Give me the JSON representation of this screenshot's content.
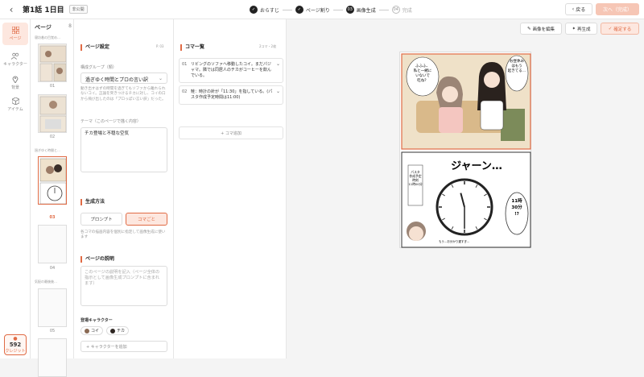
{
  "topbar": {
    "title": "第1話 1日目",
    "badge": "非公開",
    "steps": [
      {
        "num": "✓",
        "label": "おらすじ"
      },
      {
        "num": "✓",
        "label": "ページ割り"
      },
      {
        "num": "03",
        "label": "画像生成"
      },
      {
        "num": "04",
        "label": "完成"
      }
    ],
    "back_label": "戻る",
    "next_label": "次へ（完成）"
  },
  "nav": {
    "items": [
      {
        "label": "ページ",
        "icon": "grid-icon"
      },
      {
        "label": "キャラクター",
        "icon": "people-icon"
      },
      {
        "label": "背景",
        "icon": "pin-icon"
      },
      {
        "label": "アイテム",
        "icon": "box-icon"
      }
    ],
    "credit_value": "592",
    "credit_label": "クレジット"
  },
  "pages": {
    "title": "ページ",
    "count": "8",
    "groups": [
      "寝坊着の目覚め…",
      "過ぎゆく時間と…",
      "気配の最後後…"
    ],
    "thumbs": [
      "01",
      "02",
      "03",
      "04",
      "05"
    ]
  },
  "settings": {
    "title": "ページ設定",
    "page_ref": "P. 03",
    "group_label": "構成グループ（類）",
    "group_value": "過ぎゆく時間とプロの言い訳",
    "group_desc": "動き出すはずの時間を過ぎてもソファから離れられないコイ。正論を突きつけるチカに対し、コイの口から飛び出したのは「プロっぽい言い訳」だった。",
    "theme_label": "テーマ（このページで描く内容）",
    "theme_value": "チカ登場と不穏な空気",
    "method_title": "生成方法",
    "method_options": [
      "プロンプト",
      "コマごと"
    ],
    "method_hint": "各コマの描画内容を個別に指定して画像生成に使います",
    "desc_title": "ページの説明",
    "desc_placeholder": "このページの説明を記入（ページ全体の指示として画像生成プロンプトに含まれます）",
    "chars_title": "登場キャラクター",
    "chars": [
      "コイ",
      "チカ"
    ],
    "add_char": "+ キャラクターを追加"
  },
  "panels": {
    "title": "コマ一覧",
    "meta": "2コマ・2枚",
    "items": [
      {
        "num": "01",
        "text": "リビングのソファへ移動したコイ。まだパジャマ。隣では同居人のチカがコーヒーを飲んでいる。"
      },
      {
        "num": "02",
        "text": "鮭：時計の針が「11:30」を指している。(パスタ作成予定時間は11:00)"
      }
    ],
    "add_label": "+ コマ追加"
  },
  "canvas": {
    "edit_label": "画像を編集",
    "regen_label": "再生成",
    "confirm_label": "確定する"
  },
  "manga": {
    "bubble1": "お昼休みはもう起きてる…",
    "bubble2": "ふふふ、私と一緒にいないで吃ね？",
    "sfx": "ジャーン…",
    "sign": "パスタ作成予定時刻11時00分",
    "time": "11時30分!?",
    "small": "もう…お分かり遅すぎ…",
    "clock_hour": 11.5,
    "clock_minute": 30
  },
  "colors": {
    "accent": "#e06b45",
    "accent_bg": "#fde7df"
  }
}
